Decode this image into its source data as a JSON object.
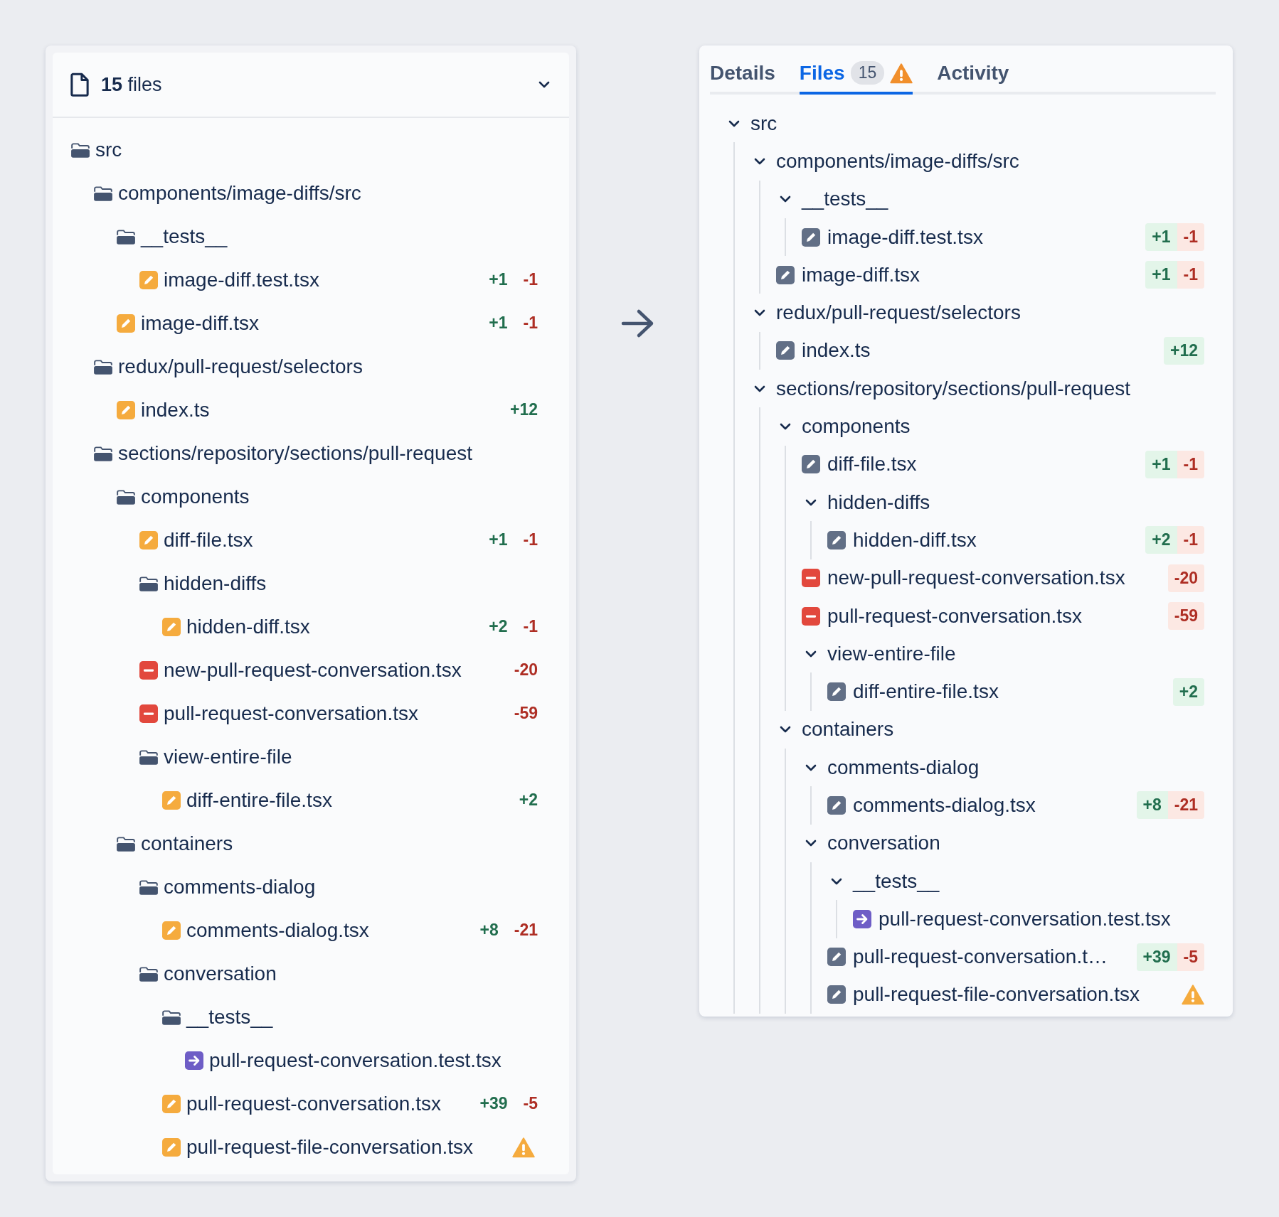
{
  "left_panel": {
    "header": {
      "title": "**15** files",
      "expanded": true
    },
    "tree": [
      {
        "kind": "folder",
        "name": "src",
        "children": [
          {
            "kind": "folder",
            "name": "components/image-diffs/src",
            "children": [
              {
                "kind": "folder",
                "name": "__tests__",
                "children": [
                  {
                    "kind": "modified",
                    "name": "image-diff.test.tsx",
                    "additions": "+1",
                    "deletions": "-1"
                  }
                ]
              },
              {
                "kind": "modified",
                "name": "image-diff.tsx",
                "additions": "+1",
                "deletions": "-1"
              }
            ]
          },
          {
            "kind": "folder",
            "name": "redux/pull-request/selectors",
            "children": [
              {
                "kind": "modified",
                "name": "index.ts",
                "additions": "+12"
              }
            ]
          },
          {
            "kind": "folder",
            "name": "sections/repository/sections/pull-request",
            "children": [
              {
                "kind": "folder",
                "name": "components",
                "children": [
                  {
                    "kind": "modified",
                    "name": "diff-file.tsx",
                    "additions": "+1",
                    "deletions": "-1"
                  },
                  {
                    "kind": "folder",
                    "name": "hidden-diffs",
                    "children": [
                      {
                        "kind": "modified",
                        "name": "hidden-diff.tsx",
                        "additions": "+2",
                        "deletions": "-1"
                      }
                    ]
                  },
                  {
                    "kind": "deleted",
                    "name": "new-pull-request-conversation.tsx",
                    "deletions": "-20"
                  },
                  {
                    "kind": "deleted",
                    "name": "pull-request-conversation.tsx",
                    "deletions": "-59"
                  },
                  {
                    "kind": "folder",
                    "name": "view-entire-file",
                    "children": [
                      {
                        "kind": "modified",
                        "name": "diff-entire-file.tsx",
                        "additions": "+2"
                      }
                    ]
                  }
                ]
              },
              {
                "kind": "folder",
                "name": "containers",
                "children": [
                  {
                    "kind": "folder",
                    "name": "comments-dialog",
                    "children": [
                      {
                        "kind": "modified",
                        "name": "comments-dialog.tsx",
                        "additions": "+8",
                        "deletions": "-21"
                      }
                    ]
                  },
                  {
                    "kind": "folder",
                    "name": "conversation",
                    "children": [
                      {
                        "kind": "folder",
                        "name": "__tests__",
                        "children": [
                          {
                            "kind": "renamed",
                            "name": "pull-request-conversation.test.tsx"
                          }
                        ]
                      },
                      {
                        "kind": "modified",
                        "name": "pull-request-conversation.tsx",
                        "additions": "+39",
                        "deletions": "-5"
                      },
                      {
                        "kind": "modified",
                        "name": "pull-request-file-conversation.tsx",
                        "warning": true
                      }
                    ]
                  }
                ]
              }
            ]
          }
        ]
      }
    ]
  },
  "right_panel": {
    "tabs": [
      {
        "label": "Details",
        "selected": false
      },
      {
        "label": "Files",
        "selected": true,
        "count": "15",
        "warning": true
      },
      {
        "label": "Activity",
        "selected": false
      }
    ],
    "tree": [
      {
        "kind": "folder",
        "name": "src",
        "expanded": true,
        "children": [
          {
            "kind": "folder",
            "name": "components/image-diffs/src",
            "expanded": true,
            "children": [
              {
                "kind": "folder",
                "name": "__tests__",
                "expanded": true,
                "children": [
                  {
                    "kind": "modified",
                    "name": "image-diff.test.tsx",
                    "additions": "+1",
                    "deletions": "-1"
                  }
                ]
              },
              {
                "kind": "modified",
                "name": "image-diff.tsx",
                "additions": "+1",
                "deletions": "-1"
              }
            ]
          },
          {
            "kind": "folder",
            "name": "redux/pull-request/selectors",
            "expanded": true,
            "children": [
              {
                "kind": "modified",
                "name": "index.ts",
                "additions": "+12"
              }
            ]
          },
          {
            "kind": "folder",
            "name": "sections/repository/sections/pull-request",
            "expanded": true,
            "children": [
              {
                "kind": "folder",
                "name": "components",
                "expanded": true,
                "children": [
                  {
                    "kind": "modified",
                    "name": "diff-file.tsx",
                    "additions": "+1",
                    "deletions": "-1"
                  },
                  {
                    "kind": "folder",
                    "name": "hidden-diffs",
                    "expanded": true,
                    "children": [
                      {
                        "kind": "modified",
                        "name": "hidden-diff.tsx",
                        "additions": "+2",
                        "deletions": "-1"
                      }
                    ]
                  },
                  {
                    "kind": "deleted",
                    "name": "new-pull-request-conversation.tsx",
                    "deletions": "-20"
                  },
                  {
                    "kind": "deleted",
                    "name": "pull-request-conversation.tsx",
                    "deletions": "-59"
                  },
                  {
                    "kind": "folder",
                    "name": "view-entire-file",
                    "expanded": true,
                    "children": [
                      {
                        "kind": "modified",
                        "name": "diff-entire-file.tsx",
                        "additions": "+2"
                      }
                    ]
                  }
                ]
              },
              {
                "kind": "folder",
                "name": "containers",
                "expanded": true,
                "children": [
                  {
                    "kind": "folder",
                    "name": "comments-dialog",
                    "expanded": true,
                    "children": [
                      {
                        "kind": "modified",
                        "name": "comments-dialog.tsx",
                        "additions": "+8",
                        "deletions": "-21"
                      }
                    ]
                  },
                  {
                    "kind": "folder",
                    "name": "conversation",
                    "expanded": true,
                    "children": [
                      {
                        "kind": "folder",
                        "name": "__tests__",
                        "expanded": true,
                        "children": [
                          {
                            "kind": "renamed",
                            "name": "pull-request-conversation.test.tsx"
                          }
                        ]
                      },
                      {
                        "kind": "modified",
                        "name": "pull-request-conversation.t…",
                        "additions": "+39",
                        "deletions": "-5"
                      },
                      {
                        "kind": "modified",
                        "name": "pull-request-file-conversation.tsx",
                        "warning": true
                      }
                    ]
                  }
                ]
              }
            ]
          }
        ]
      }
    ]
  }
}
